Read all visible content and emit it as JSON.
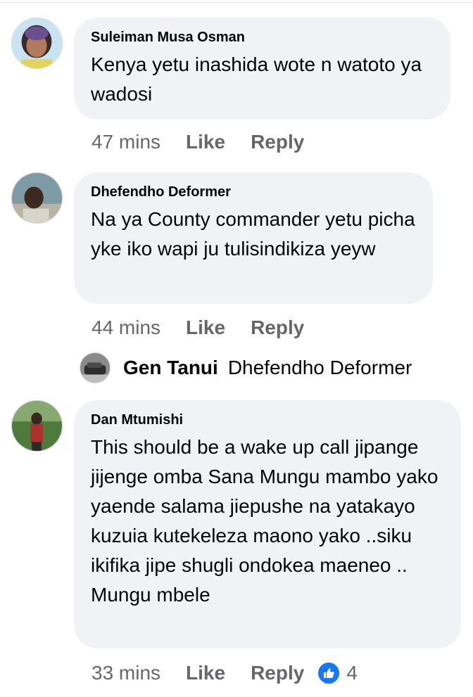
{
  "comments": [
    {
      "author": "Suleiman Musa Osman",
      "text": "Kenya yetu inashida wote n watoto ya wadosi",
      "time": "47 mins",
      "like_label": "Like",
      "reply_label": "Reply"
    },
    {
      "author": "Dhefendho Deformer",
      "text": "Na ya County commander yetu picha yke iko wapi ju tulisindikiza yeyw",
      "time": "44 mins",
      "like_label": "Like",
      "reply_label": "Reply"
    },
    {
      "author": "Dan Mtumishi",
      "text": "This should be a wake up call jipange jijenge omba Sana Mungu mambo yako yaende salama jiepushe na yatakayo kuzuia kutekeleza maono yako ..siku ikifika jipe shugli ondokea maeneo .. Mungu mbele",
      "time": "33 mins",
      "like_label": "Like",
      "reply_label": "Reply",
      "reaction_icon": "thumbs-up-icon",
      "reaction_count": "4"
    }
  ],
  "reply_preview": {
    "author": "Gen Tanui",
    "text": "Dhefendho Deformer"
  },
  "colors": {
    "bubble": "#f0f2f5",
    "meta_text": "#65676b",
    "like_blue": "#1877f2"
  }
}
